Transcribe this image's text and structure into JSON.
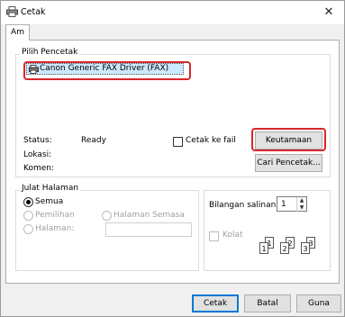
{
  "window": {
    "title": "Cetak",
    "close_label": "✕"
  },
  "tabs": [
    {
      "label": "Am"
    }
  ],
  "printer_group": {
    "title": "Pilih Pencetak",
    "printers": [
      {
        "name": "Canon Generic FAX Driver (FAX)",
        "selected": true
      }
    ],
    "status_label": "Status:",
    "status_value": "Ready",
    "location_label": "Lokasi:",
    "location_value": "",
    "comment_label": "Komen:",
    "comment_value": "",
    "print_to_file_label": "Cetak ke fail",
    "print_to_file_checked": false,
    "preferences_button": "Keutamaan",
    "find_printer_button": "Cari Pencetak..."
  },
  "page_range": {
    "title": "Julat Halaman",
    "options": [
      {
        "label": "Semua",
        "checked": true,
        "enabled": true
      },
      {
        "label": "Pemilihan",
        "checked": false,
        "enabled": false
      },
      {
        "label": "Halaman Semasa",
        "checked": false,
        "enabled": false
      },
      {
        "label": "Halaman:",
        "checked": false,
        "enabled": false
      }
    ],
    "pages_value": ""
  },
  "copies": {
    "label": "Bilangan salinan:",
    "value": "1",
    "collate_label": "Kolat",
    "collate_checked": false,
    "collate_icon_pages": [
      "1",
      "1",
      "2",
      "2",
      "3",
      "3"
    ]
  },
  "footer": {
    "print_button": "Cetak",
    "cancel_button": "Batal",
    "apply_button": "Guna"
  },
  "colors": {
    "highlight": "#d9262b",
    "selection": "#cce8ff",
    "accent": "#0078d7"
  }
}
